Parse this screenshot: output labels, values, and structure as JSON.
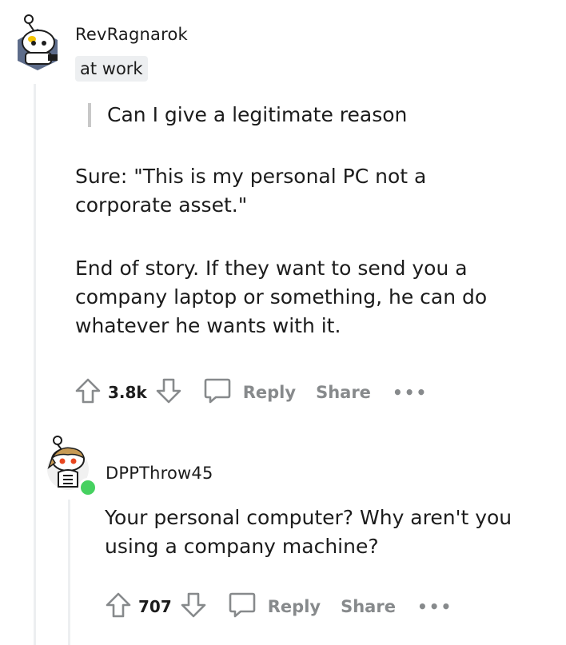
{
  "comment1": {
    "username": "RevRagnarok",
    "flair": "at work",
    "quote": "Can I give a legitimate reason",
    "paragraph1": "Sure: \"This is my personal PC not a corporate asset.\"",
    "paragraph2": "End of story. If they want to send you a company laptop or something, he can do whatever he wants with it.",
    "votes": "3.8k",
    "reply_label": "Reply",
    "share_label": "Share",
    "more_label": "•••"
  },
  "comment2": {
    "username": "DPPThrow45",
    "text": "Your personal computer? Why aren't you using a company machine?",
    "votes": "707",
    "reply_label": "Reply",
    "share_label": "Share",
    "more_label": "•••"
  }
}
